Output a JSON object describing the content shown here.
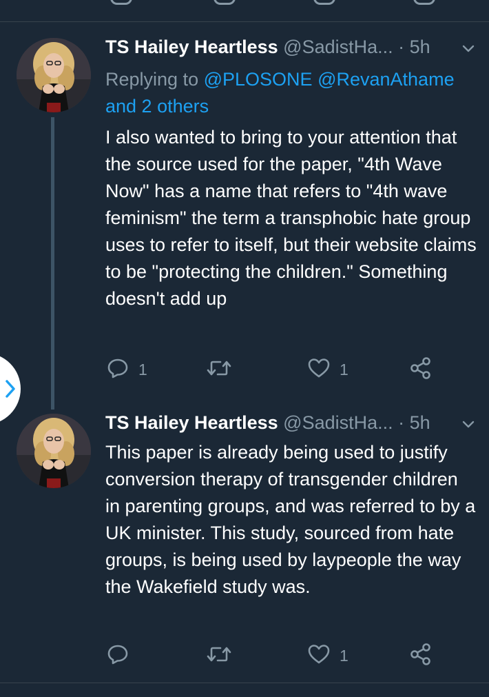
{
  "colors": {
    "background": "#1b2836",
    "text_primary": "#ffffff",
    "text_secondary": "#8899a6",
    "link": "#1da1f2",
    "divider": "#38444d",
    "thread_line": "#3d5466"
  },
  "tweets": [
    {
      "author_name": "TS Hailey Heartless",
      "handle": "@SadistHa...",
      "dot": "·",
      "time": "5h",
      "replying_prefix": "Replying to",
      "replying_user1": "@PLOSONE",
      "replying_user2": "@RevanAthame",
      "replying_others": "and 2 others",
      "text": "I also wanted to bring to your attention that the source used for the paper, \"4th Wave Now\" has a name that refers to \"4th wave feminism\" the term a transphobic hate group uses to refer to itself, but their website claims to be \"protecting the children.\" Something doesn't add up",
      "reply_count": "1",
      "retweet_count": "",
      "like_count": "1",
      "icons": [
        "reply-icon",
        "retweet-icon",
        "like-icon",
        "share-icon",
        "chevron-down-icon"
      ]
    },
    {
      "author_name": "TS Hailey Heartless",
      "handle": "@SadistHa...",
      "dot": "·",
      "time": "5h",
      "text": "This paper is already being used to justify conversion therapy of transgender children in parenting groups, and was referred to by a UK minister. This study, sourced from hate groups, is being used by laypeople the way the Wakefield study was.",
      "reply_count": "",
      "retweet_count": "",
      "like_count": "1",
      "icons": [
        "reply-icon",
        "retweet-icon",
        "like-icon",
        "share-icon",
        "chevron-down-icon"
      ]
    }
  ],
  "side_tab": {
    "icon": "chevron-right-icon"
  }
}
